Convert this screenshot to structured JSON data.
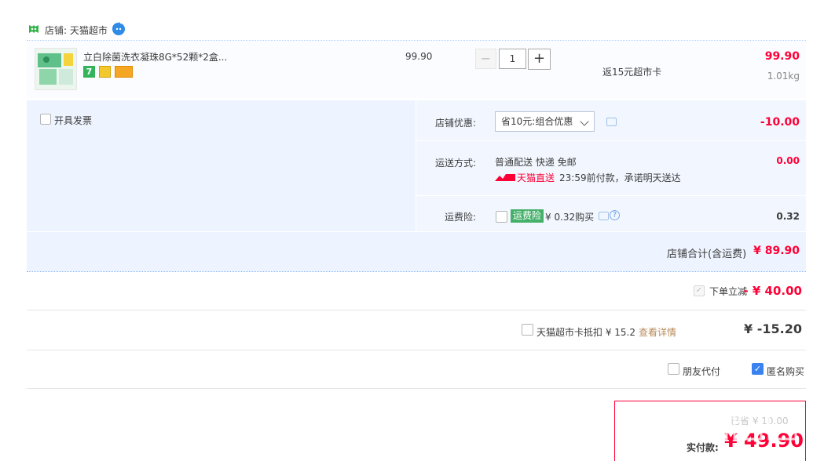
{
  "store": {
    "label": "店铺: 天猫超市",
    "chat_icon": "wangwang-icon"
  },
  "item": {
    "title": "立白除菌洗衣凝珠8G*52颗*2盒...",
    "unit_price": "99.90",
    "quantity": "1",
    "return_card": "返15元超市卡",
    "total": "99.90",
    "weight": "1.01kg",
    "badges": [
      "seven-day-return-icon",
      "guarantee-icon",
      "card-pay-icon"
    ],
    "badge_seven": "7"
  },
  "invoice": {
    "label": "开具发票"
  },
  "shop_discount": {
    "label": "店铺优惠:",
    "selected": "省10元:组合优惠",
    "amount": "-10.00"
  },
  "shipping": {
    "label": "运送方式:",
    "method": "普通配送 快递 免邮",
    "express_label": "天猫直送",
    "promise": "23:59前付款，承诺明天送达",
    "amount": "0.00"
  },
  "insurance": {
    "label": "运费险:",
    "badge": "运费险",
    "price": "¥ 0.32购买",
    "amount": "0.32",
    "help": "?"
  },
  "shop_total": {
    "label": "店铺合计(含运费)",
    "amount": "¥ 89.90"
  },
  "instant_discount": {
    "label": "下单立减",
    "amount": "- ¥ 40.00"
  },
  "supermarket_card": {
    "label": "天猫超市卡抵扣 ¥ 15.2",
    "link": "查看详情",
    "amount": "¥ -15.20"
  },
  "friend_pay": {
    "label": "朋友代付"
  },
  "anonymous": {
    "label": "匿名购买"
  },
  "payment": {
    "faint": "已省 ¥ 10.00",
    "label": "实付款:",
    "amount": "¥ 49.90"
  },
  "colors": {
    "accent_red": "#ff0036",
    "panel_blue": "#eef4ff",
    "checkbox_blue": "#3a82f0",
    "insurance_green": "#45b06a"
  }
}
